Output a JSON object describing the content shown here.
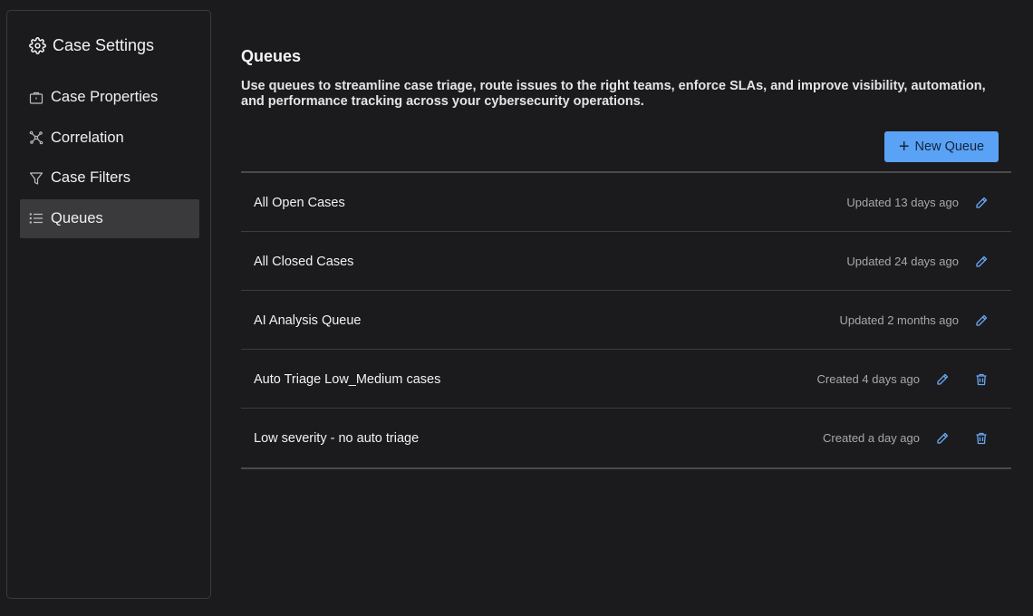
{
  "sidebar": {
    "title": "Case Settings",
    "title_icon": "gear-icon",
    "items": [
      {
        "label": "Case Properties",
        "icon": "briefcase-icon",
        "active": false
      },
      {
        "label": "Correlation",
        "icon": "network-icon",
        "active": false
      },
      {
        "label": "Case Filters",
        "icon": "filter-icon",
        "active": false
      },
      {
        "label": "Queues",
        "icon": "list-icon",
        "active": true
      }
    ]
  },
  "main": {
    "title": "Queues",
    "description": "Use queues to streamline case triage, route issues to the right teams, enforce SLAs, and improve visibility, automation, and performance tracking across your cybersecurity operations.",
    "new_queue_label": "New Queue",
    "queues": [
      {
        "name": "All Open Cases",
        "meta": "Updated 13 days ago",
        "editable": true,
        "deletable": false
      },
      {
        "name": "All Closed Cases",
        "meta": "Updated 24 days ago",
        "editable": true,
        "deletable": false
      },
      {
        "name": "AI Analysis Queue",
        "meta": "Updated 2 months ago",
        "editable": true,
        "deletable": false
      },
      {
        "name": "Auto Triage Low_Medium cases",
        "meta": "Created 4 days ago",
        "editable": true,
        "deletable": true
      },
      {
        "name": "Low severity - no auto triage",
        "meta": "Created a day ago",
        "editable": true,
        "deletable": true
      }
    ]
  },
  "colors": {
    "background": "#1b1b1d",
    "accent": "#5aa2f5",
    "active_nav": "#3a3a3c",
    "icon_blue": "#6aa6f0"
  }
}
